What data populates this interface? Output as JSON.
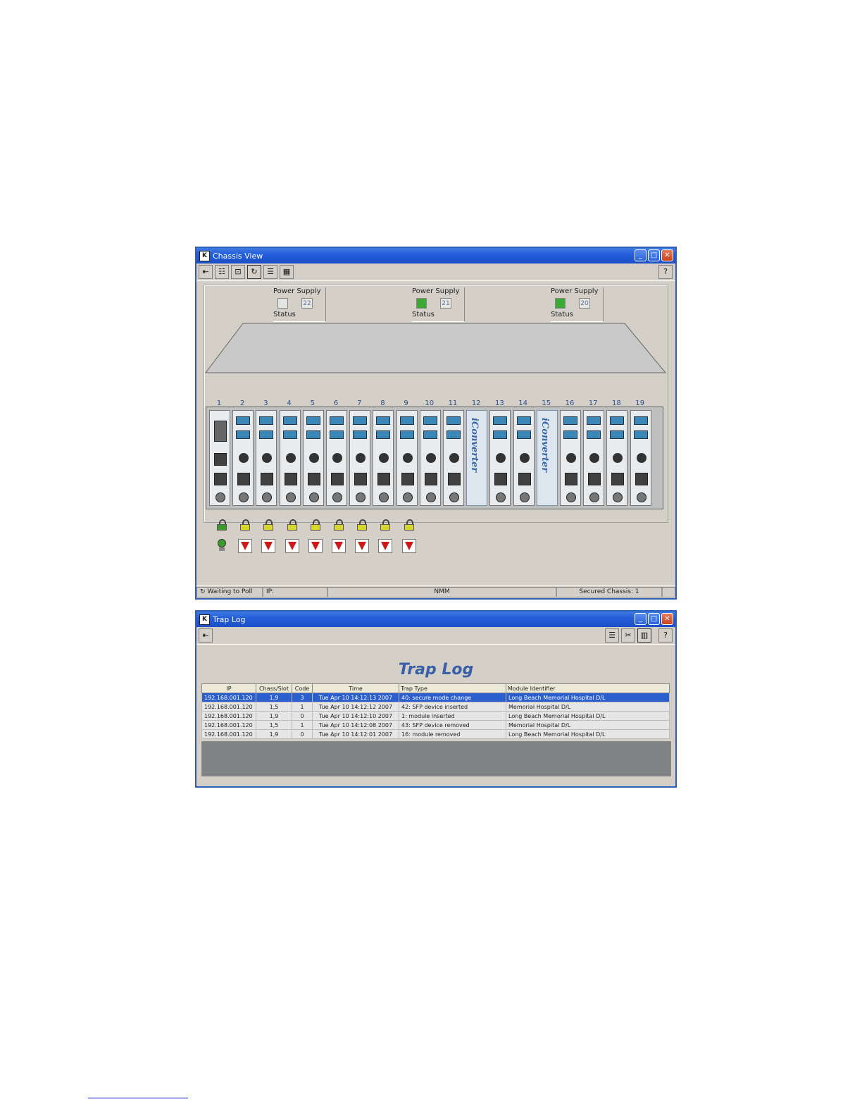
{
  "chassis_window": {
    "title": "Chassis View",
    "toolbar_help": "?",
    "power_supplies": [
      {
        "label": "Power Supply",
        "number": "22",
        "status_label": "Status",
        "status_color": "#e4e4e4"
      },
      {
        "label": "Power Supply",
        "number": "21",
        "status_label": "Status",
        "status_color": "#3aaa35"
      },
      {
        "label": "Power Supply",
        "number": "20",
        "status_label": "Status",
        "status_color": "#3aaa35"
      }
    ],
    "slot_numbers": [
      "1",
      "2",
      "3",
      "4",
      "5",
      "6",
      "7",
      "8",
      "9",
      "10",
      "11",
      "12",
      "13",
      "14",
      "15",
      "16",
      "17",
      "18",
      "19"
    ],
    "blank_panel_text": "iConverter",
    "lock_colors": {
      "green": "#3b9b2b",
      "yellow": "#d8d82c"
    },
    "statusbar": {
      "poll": "Waiting to Poll",
      "ip": "IP:",
      "mode": "NMM",
      "secured": "Secured Chassis: 1"
    }
  },
  "trap_window": {
    "title": "Trap Log",
    "heading": "Trap Log",
    "toolbar_help": "?",
    "columns": [
      "IP",
      "Chass/Slot",
      "Code",
      "Time",
      "Trap Type",
      "Module Identifier"
    ],
    "rows": [
      [
        "192.168.001.120",
        "1,9",
        "3",
        "Tue Apr 10 14:12:13 2007",
        "40: secure mode change",
        "Long Beach Memorial Hospital D/L"
      ],
      [
        "192.168.001.120",
        "1,5",
        "1",
        "Tue Apr 10 14:12:12 2007",
        "42: SFP device inserted",
        "Memorial Hospital D/L"
      ],
      [
        "192.168.001.120",
        "1,9",
        "0",
        "Tue Apr 10 14:12:10 2007",
        "1: module inserted",
        "Long Beach Memorial Hospital D/L"
      ],
      [
        "192.168.001.120",
        "1,5",
        "1",
        "Tue Apr 10 14:12:08 2007",
        "43: SFP device removed",
        "Memorial Hospital D/L"
      ],
      [
        "192.168.001.120",
        "1,9",
        "0",
        "Tue Apr 10 14:12:01 2007",
        "16: module removed",
        "Long Beach Memorial Hospital D/L"
      ]
    ],
    "selected_row": 0
  }
}
